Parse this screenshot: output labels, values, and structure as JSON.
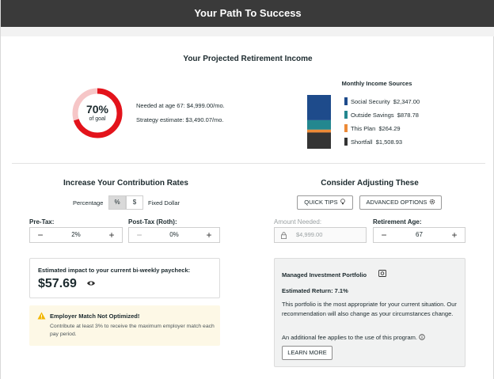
{
  "header": {
    "title": "Your Path To Success"
  },
  "projected": {
    "title": "Your Projected Retirement Income",
    "percent": "70%",
    "percent_value": 0.7,
    "of_goal": "of goal",
    "needed_label": "Needed at age 67:",
    "needed_value": "$4,999.00/mo.",
    "strategy_label": "Strategy estimate:",
    "strategy_value": "$3,490.07/mo.",
    "colors": {
      "progress": "#e3131b",
      "track": "#f6c6c7"
    }
  },
  "sources": {
    "title": "Monthly Income Sources",
    "items": [
      {
        "label": "Social Security",
        "value": "$2,347.00",
        "amount": 2347.0,
        "color": "#1e4b8b"
      },
      {
        "label": "Outside Savings",
        "value": "$878.78",
        "amount": 878.78,
        "color": "#23878f"
      },
      {
        "label": "This Plan",
        "value": "$264.29",
        "amount": 264.29,
        "color": "#ec8a37"
      },
      {
        "label": "Shortfall",
        "value": "$1,508.93",
        "amount": 1508.93,
        "color": "#343434"
      }
    ]
  },
  "contrib": {
    "title": "Increase Your Contribution Rates",
    "percentage_label": "Percentage",
    "pct_btn": "%",
    "dollar_btn": "$",
    "fixed_label": "Fixed Dollar",
    "pretax_label": "Pre-Tax:",
    "pretax_value": "2%",
    "posttax_label": "Post-Tax (Roth):",
    "posttax_value": "0%",
    "minus": "−",
    "plus": "+",
    "impact_label": "Estimated impact to your current bi-weekly paycheck:",
    "impact_value": "$57.69",
    "warn_title": "Employer Match Not Optimized!",
    "warn_text": "Contribute at least 3% to receive the maximum employer match each pay period."
  },
  "adjust": {
    "title": "Consider Adjusting These",
    "quick_tips": "QUICK TIPS",
    "advanced": "ADVANCED OPTIONS",
    "amount_label": "Amount Needed:",
    "amount_value": "$4,999.00",
    "age_label": "Retirement Age:",
    "age_value": "67"
  },
  "portfolio": {
    "title": "Managed Investment Portfolio",
    "return": "Estimated Return: 7.1%",
    "text": "This portfolio is the most appropriate for your current situation. Our recommendation will also change as your circumstances change.",
    "fee": "An additional fee applies to the use of this program.",
    "learn_more": "LEARN MORE"
  }
}
